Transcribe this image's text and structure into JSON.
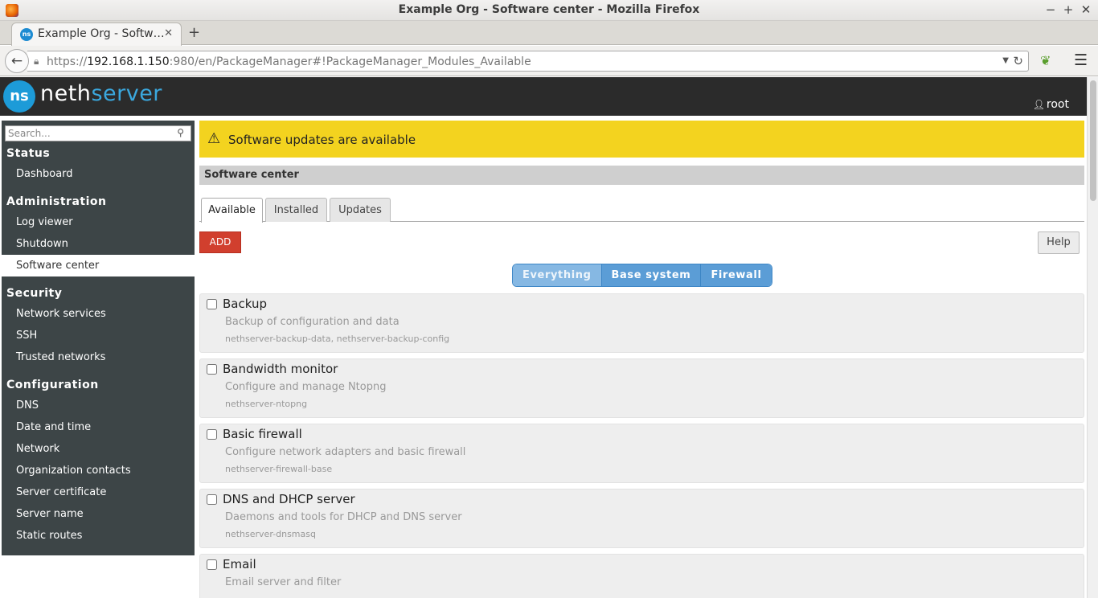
{
  "window": {
    "title": "Example Org - Software center - Mozilla Firefox",
    "minimize": "−",
    "maximize": "+",
    "close": "✕"
  },
  "browser": {
    "tab_label": "Example Org - Softw…",
    "tab_close": "✕",
    "new_tab": "+",
    "url_scheme": "https://",
    "url_host": "192.168.1.150",
    "url_rest": ":980/en/PackageManager#!PackageManager_Modules_Available"
  },
  "header": {
    "logo_mark": "ns",
    "logo_word1": "neth",
    "logo_word2": "server",
    "user": "root"
  },
  "sidebar": {
    "search_placeholder": "Search...",
    "sections": [
      {
        "title": "Status",
        "items": [
          "Dashboard"
        ]
      },
      {
        "title": "Administration",
        "items": [
          "Log viewer",
          "Shutdown",
          "Software center"
        ]
      },
      {
        "title": "Security",
        "items": [
          "Network services",
          "SSH",
          "Trusted networks"
        ]
      },
      {
        "title": "Configuration",
        "items": [
          "DNS",
          "Date and time",
          "Network",
          "Organization contacts",
          "Server certificate",
          "Server name",
          "Static routes"
        ]
      }
    ],
    "active_item": "Software center"
  },
  "main": {
    "alert": "Software updates are available",
    "section_title": "Software center",
    "tabs": [
      "Available",
      "Installed",
      "Updates"
    ],
    "active_tab": "Available",
    "add_label": "ADD",
    "help_label": "Help",
    "filters": [
      "Everything",
      "Base system",
      "Firewall"
    ],
    "active_filter": "Everything",
    "packages": [
      {
        "name": "Backup",
        "desc": "Backup of configuration and data",
        "rpms": "nethserver-backup-data, nethserver-backup-config"
      },
      {
        "name": "Bandwidth monitor",
        "desc": "Configure and manage Ntopng",
        "rpms": "nethserver-ntopng"
      },
      {
        "name": "Basic firewall",
        "desc": "Configure network adapters and basic firewall",
        "rpms": "nethserver-firewall-base"
      },
      {
        "name": "DNS and DHCP server",
        "desc": "Daemons and tools for DHCP and DNS server",
        "rpms": "nethserver-dnsmasq"
      },
      {
        "name": "Email",
        "desc": "Email server and filter",
        "rpms": ""
      }
    ]
  },
  "colors": {
    "alert": "#f3d31f",
    "add_button": "#d13f2e",
    "brand_blue": "#1d9bd8",
    "sidebar_bg": "#3d4547",
    "filter_blue": "#5b9dd6"
  }
}
